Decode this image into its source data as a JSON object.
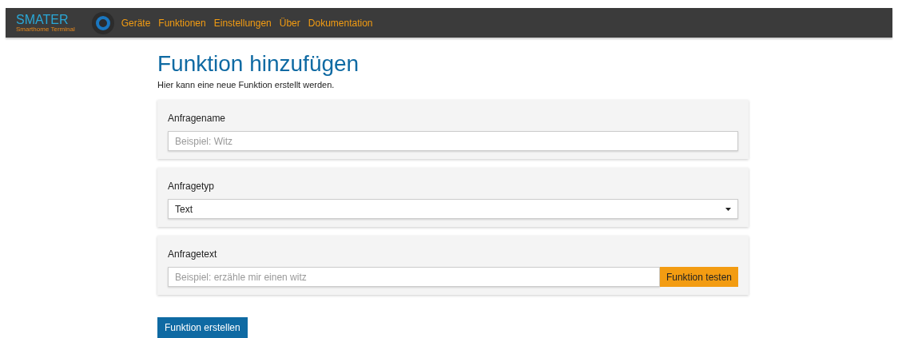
{
  "nav": {
    "logo": "SMATER",
    "logo_subtitle": "Smarthome Terminal",
    "items": [
      {
        "label": "Geräte"
      },
      {
        "label": "Funktionen"
      },
      {
        "label": "Einstellungen"
      },
      {
        "label": "Über"
      },
      {
        "label": "Dokumentation"
      }
    ]
  },
  "heading": "Funktion hinzufügen",
  "intro": "Hier kann eine neue Funktion erstellt werden.",
  "fields": [
    {
      "kind": "text",
      "label": "Anfragename",
      "placeholder": "Beispiel: Witz"
    },
    {
      "kind": "select",
      "label": "Anfragetyp",
      "value": "Text"
    },
    {
      "kind": "text_button",
      "label": "Anfragetext",
      "placeholder": "Beispiel: erzähle mir einen witz",
      "button": "Funktion testen"
    }
  ],
  "submit": "Funktion erstellen"
}
